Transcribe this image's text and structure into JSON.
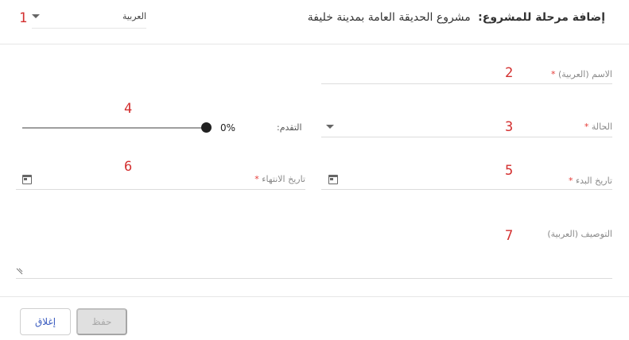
{
  "header": {
    "title_prefix": "إضافة مرحلة للمشروع:",
    "project_name": "مشروع الحديقة العامة بمدينة خليفة",
    "language_select": "العربية"
  },
  "form": {
    "name_label": "الاسم (العربية)",
    "status_label": "الحالة",
    "progress_label": "التقدم:",
    "progress_value_text": "0%",
    "progress_fraction": 1.0,
    "start_date_label": "تاريخ البدء",
    "end_date_label": "تاريخ الانتهاء",
    "description_label": "التوصيف (العربية)",
    "required_marker": "*"
  },
  "annotations": [
    "1",
    "2",
    "3",
    "4",
    "5",
    "6",
    "7"
  ],
  "footer": {
    "save_label": "حفظ",
    "close_label": "إغلاق"
  },
  "colors": {
    "required": "#e53935",
    "annotation": "#d32f2f",
    "close_text": "#3a5bbf",
    "save_disabled_bg": "#e0e0e0"
  }
}
